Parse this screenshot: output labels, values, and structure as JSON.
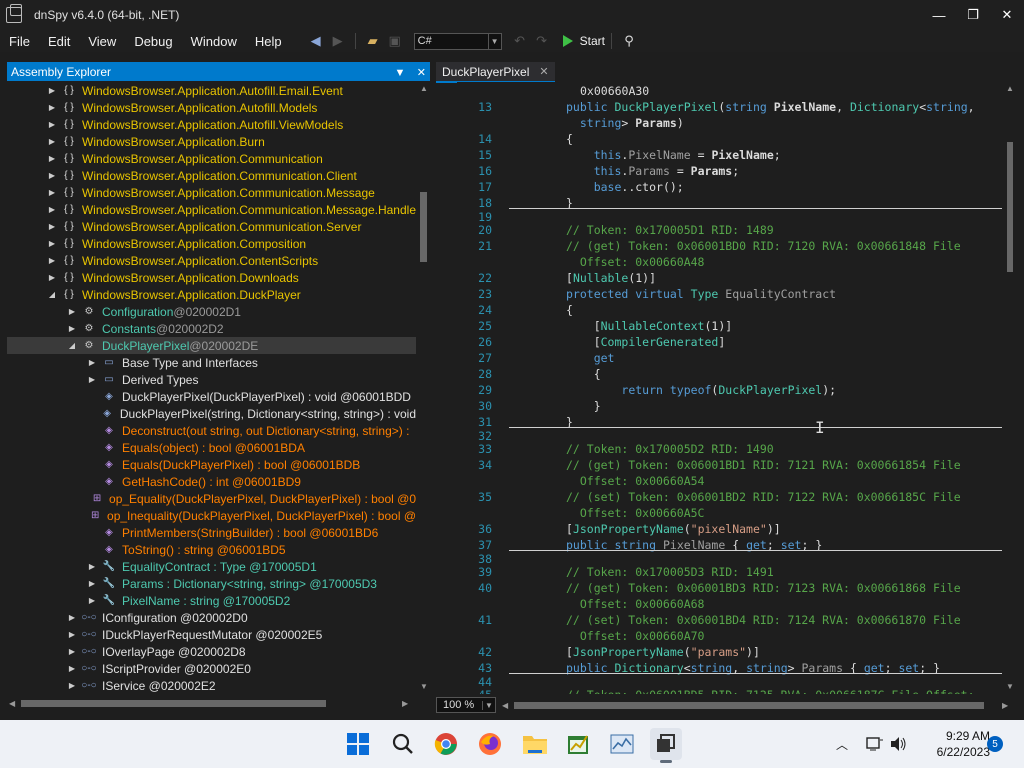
{
  "window": {
    "title": "dnSpy v6.4.0 (64-bit, .NET)",
    "controls": {
      "minimize": "—",
      "restore": "❐",
      "close": "✕"
    }
  },
  "menu": [
    "File",
    "Edit",
    "View",
    "Debug",
    "Window",
    "Help"
  ],
  "toolbar": {
    "language": "C#",
    "start_label": "Start"
  },
  "assembly_explorer": {
    "title": "Assembly Explorer",
    "items": [
      {
        "level": 2,
        "exp": "▶",
        "icon": "{ }",
        "text": "WindowsBrowser.Application.Autofill.Email.Event",
        "kind": "ns"
      },
      {
        "level": 2,
        "exp": "▶",
        "icon": "{ }",
        "text": "WindowsBrowser.Application.Autofill.Models",
        "kind": "ns"
      },
      {
        "level": 2,
        "exp": "▶",
        "icon": "{ }",
        "text": "WindowsBrowser.Application.Autofill.ViewModels",
        "kind": "ns"
      },
      {
        "level": 2,
        "exp": "▶",
        "icon": "{ }",
        "text": "WindowsBrowser.Application.Burn",
        "kind": "ns"
      },
      {
        "level": 2,
        "exp": "▶",
        "icon": "{ }",
        "text": "WindowsBrowser.Application.Communication",
        "kind": "ns"
      },
      {
        "level": 2,
        "exp": "▶",
        "icon": "{ }",
        "text": "WindowsBrowser.Application.Communication.Client",
        "kind": "ns"
      },
      {
        "level": 2,
        "exp": "▶",
        "icon": "{ }",
        "text": "WindowsBrowser.Application.Communication.Message",
        "kind": "ns"
      },
      {
        "level": 2,
        "exp": "▶",
        "icon": "{ }",
        "text": "WindowsBrowser.Application.Communication.Message.Handle",
        "kind": "ns"
      },
      {
        "level": 2,
        "exp": "▶",
        "icon": "{ }",
        "text": "WindowsBrowser.Application.Communication.Server",
        "kind": "ns"
      },
      {
        "level": 2,
        "exp": "▶",
        "icon": "{ }",
        "text": "WindowsBrowser.Application.Composition",
        "kind": "ns"
      },
      {
        "level": 2,
        "exp": "▶",
        "icon": "{ }",
        "text": "WindowsBrowser.Application.ContentScripts",
        "kind": "ns"
      },
      {
        "level": 2,
        "exp": "▶",
        "icon": "{ }",
        "text": "WindowsBrowser.Application.Downloads",
        "kind": "ns"
      },
      {
        "level": 2,
        "exp": "◢",
        "icon": "{ }",
        "text": "WindowsBrowser.Application.DuckPlayer",
        "kind": "ns"
      },
      {
        "level": 3,
        "exp": "▶",
        "icon": "⚙",
        "text": "Configuration",
        "tok": " @020002D1",
        "kind": "grey"
      },
      {
        "level": 3,
        "exp": "▶",
        "icon": "⚙",
        "text": "Constants",
        "tok": " @020002D2",
        "kind": "grey"
      },
      {
        "level": 3,
        "exp": "◢",
        "icon": "⚙",
        "text": "DuckPlayerPixel",
        "tok": " @020002DE",
        "kind": "grey",
        "selected": true
      },
      {
        "level": 4,
        "exp": "▶",
        "icon": "▭",
        "text": "Base Type and Interfaces",
        "kind": "wht"
      },
      {
        "level": 4,
        "exp": "▶",
        "icon": "▭",
        "text": "Derived Types",
        "kind": "wht"
      },
      {
        "level": 4,
        "exp": "",
        "icon": "◈",
        "text": "DuckPlayerPixel(DuckPlayerPixel) : void @06001BDD",
        "kind": "wht"
      },
      {
        "level": 4,
        "exp": "",
        "icon": "◈",
        "text": "DuckPlayerPixel(string, Dictionary<string, string>) : void",
        "kind": "wht"
      },
      {
        "level": 4,
        "exp": "",
        "icon": "◈",
        "text": "Deconstruct(out string, out Dictionary<string, string>) :",
        "kind": "mth"
      },
      {
        "level": 4,
        "exp": "",
        "icon": "◈",
        "text": "Equals(object) : bool @06001BDA",
        "kind": "mth"
      },
      {
        "level": 4,
        "exp": "",
        "icon": "◈",
        "text": "Equals(DuckPlayerPixel) : bool @06001BDB",
        "kind": "mth"
      },
      {
        "level": 4,
        "exp": "",
        "icon": "◈",
        "text": "GetHashCode() : int @06001BD9",
        "kind": "mth"
      },
      {
        "level": 4,
        "exp": "",
        "icon": "⊞",
        "text": "op_Equality(DuckPlayerPixel, DuckPlayerPixel) : bool @0",
        "kind": "mth"
      },
      {
        "level": 4,
        "exp": "",
        "icon": "⊞",
        "text": "op_Inequality(DuckPlayerPixel, DuckPlayerPixel) : bool @",
        "kind": "mth"
      },
      {
        "level": 4,
        "exp": "",
        "icon": "◈",
        "text": "PrintMembers(StringBuilder) : bool @06001BD6",
        "kind": "mth"
      },
      {
        "level": 4,
        "exp": "",
        "icon": "◈",
        "text": "ToString() : string @06001BD5",
        "kind": "mth"
      },
      {
        "level": 4,
        "exp": "▶",
        "icon": "🔧",
        "text": "EqualityContract : Type @170005D1",
        "kind": "grey"
      },
      {
        "level": 4,
        "exp": "▶",
        "icon": "🔧",
        "text": "Params : Dictionary<string, string> @170005D3",
        "kind": "grey"
      },
      {
        "level": 4,
        "exp": "▶",
        "icon": "🔧",
        "text": "PixelName : string @170005D2",
        "kind": "grey"
      },
      {
        "level": 3,
        "exp": "▶",
        "icon": "○-○",
        "text": "IConfiguration @020002D0",
        "kind": "wht"
      },
      {
        "level": 3,
        "exp": "▶",
        "icon": "○-○",
        "text": "IDuckPlayerRequestMutator @020002E5",
        "kind": "wht"
      },
      {
        "level": 3,
        "exp": "▶",
        "icon": "○-○",
        "text": "IOverlayPage @020002D8",
        "kind": "wht"
      },
      {
        "level": 3,
        "exp": "▶",
        "icon": "○-○",
        "text": "IScriptProvider @020002E0",
        "kind": "wht"
      },
      {
        "level": 3,
        "exp": "▶",
        "icon": "○-○",
        "text": "IService @020002E2",
        "kind": "wht"
      }
    ]
  },
  "editor_tab": {
    "label": "DuckPlayerPixel",
    "close": "✕"
  },
  "code": {
    "first_line_text": "0x00660A30",
    "lines": [
      {
        "n": "13",
        "html": "<span class='k'>public</span> <span class='t'>DuckPlayerPixel</span>(<span class='k'>string</span> <span class='b'>PixelName</span>, <span class='t'>Dictionary</span>&lt;<span class='k'>string</span>,"
      },
      {
        "n": "",
        "html": "  <span class='k'>string</span>&gt; <span class='b'>Params</span>)"
      },
      {
        "n": "14",
        "html": "{"
      },
      {
        "n": "15",
        "html": "    <span class='k'>this</span>.<span class='p'>PixelName</span> = <span class='b'>PixelName</span>;"
      },
      {
        "n": "16",
        "html": "    <span class='k'>this</span>.<span class='p'>Params</span> = <span class='b'>Params</span>;"
      },
      {
        "n": "17",
        "html": "    <span class='k'>base</span>..ctor();"
      },
      {
        "n": "18",
        "html": "}"
      },
      {
        "n": "19",
        "html": ""
      },
      {
        "n": "20",
        "html": "<span class='c'>// Token: 0x170005D1 RID: 1489</span>"
      },
      {
        "n": "21",
        "html": "<span class='c'>// (get) Token: 0x06001BD0 RID: 7120 RVA: 0x00661848 File</span>"
      },
      {
        "n": "",
        "html": "<span class='c'>  Offset: 0x00660A48</span>"
      },
      {
        "n": "22",
        "html": "[<span class='t'>Nullable</span>(1)]"
      },
      {
        "n": "23",
        "html": "<span class='k'>protected</span> <span class='k'>virtual</span> <span class='t'>Type</span> <span class='p'>EqualityContract</span>"
      },
      {
        "n": "24",
        "html": "{"
      },
      {
        "n": "25",
        "html": "    [<span class='t'>NullableContext</span>(1)]"
      },
      {
        "n": "26",
        "html": "    [<span class='t'>CompilerGenerated</span>]"
      },
      {
        "n": "27",
        "html": "    <span class='k'>get</span>"
      },
      {
        "n": "28",
        "html": "    {"
      },
      {
        "n": "29",
        "html": "        <span class='k'>return</span> <span class='k'>typeof</span>(<span class='t'>DuckPlayerPixel</span>);"
      },
      {
        "n": "30",
        "html": "    }"
      },
      {
        "n": "31",
        "html": "}"
      },
      {
        "n": "32",
        "html": ""
      },
      {
        "n": "33",
        "html": "<span class='c'>// Token: 0x170005D2 RID: 1490</span>"
      },
      {
        "n": "34",
        "html": "<span class='c'>// (get) Token: 0x06001BD1 RID: 7121 RVA: 0x00661854 File</span>"
      },
      {
        "n": "",
        "html": "<span class='c'>  Offset: 0x00660A54</span>"
      },
      {
        "n": "35",
        "html": "<span class='c'>// (set) Token: 0x06001BD2 RID: 7122 RVA: 0x0066185C File</span>"
      },
      {
        "n": "",
        "html": "<span class='c'>  Offset: 0x00660A5C</span>"
      },
      {
        "n": "36",
        "html": "[<span class='t'>JsonPropertyName</span>(<span class='s'>\"pixelName\"</span>)]"
      },
      {
        "n": "37",
        "html": "<span class='k'>public</span> <span class='k'>string</span> <span class='p'>PixelName</span> { <span class='k'>get</span>; <span class='k'>set</span>; }"
      },
      {
        "n": "38",
        "html": ""
      },
      {
        "n": "39",
        "html": "<span class='c'>// Token: 0x170005D3 RID: 1491</span>"
      },
      {
        "n": "40",
        "html": "<span class='c'>// (get) Token: 0x06001BD3 RID: 7123 RVA: 0x00661868 File</span>"
      },
      {
        "n": "",
        "html": "<span class='c'>  Offset: 0x00660A68</span>"
      },
      {
        "n": "41",
        "html": "<span class='c'>// (set) Token: 0x06001BD4 RID: 7124 RVA: 0x00661870 File</span>"
      },
      {
        "n": "",
        "html": "<span class='c'>  Offset: 0x00660A70</span>"
      },
      {
        "n": "42",
        "html": "[<span class='t'>JsonPropertyName</span>(<span class='s'>\"params\"</span>)]"
      },
      {
        "n": "43",
        "html": "<span class='k'>public</span> <span class='t'>Dictionary</span>&lt;<span class='k'>string</span>, <span class='k'>string</span>&gt; <span class='p'>Params</span> { <span class='k'>get</span>; <span class='k'>set</span>; }"
      },
      {
        "n": "44",
        "html": ""
      },
      {
        "n": "45",
        "html": "<span class='c'>// Token: 0x06001BD5 RID: 7125 RVA: 0x0066187C File Offset:</span>"
      }
    ]
  },
  "status": {
    "zoom": "100 %"
  },
  "taskbar": {
    "time": "9:29 AM",
    "date": "6/22/2023",
    "notifications": "5"
  },
  "colors": {
    "accent": "#007acc",
    "namespace": "#e8c400",
    "method": "#ff8000",
    "comment": "#57a64a",
    "keyword": "#569cd6"
  }
}
